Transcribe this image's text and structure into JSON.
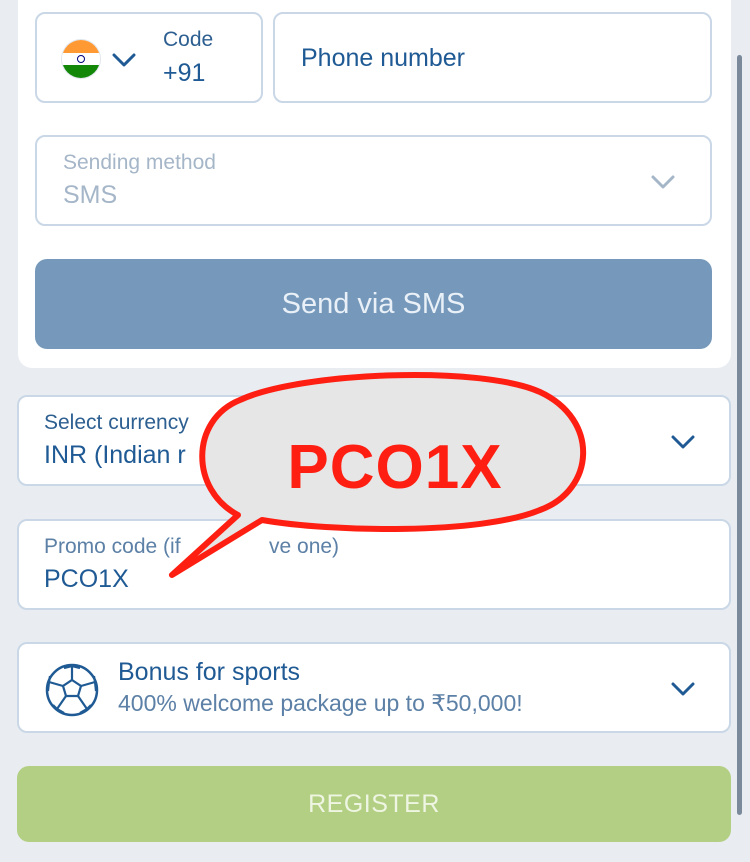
{
  "phone": {
    "country_flag": "india-flag-icon",
    "code_label": "Code",
    "code_value": "+91",
    "phone_placeholder": "Phone number"
  },
  "sending_method": {
    "label": "Sending method",
    "value": "SMS"
  },
  "send_button": "Send via SMS",
  "currency": {
    "label": "Select currency",
    "value": "INR (Indian r"
  },
  "promo": {
    "label": "Promo code (if",
    "label_tail": "ve one)",
    "value": "PCO1X"
  },
  "bonus": {
    "title": "Bonus for sports",
    "subtitle": "400% welcome package up to ₹50,000!",
    "icon": "soccer-ball-icon"
  },
  "register_button": "REGISTER",
  "callout": {
    "text": "PCO1X"
  },
  "colors": {
    "accent_blue": "#1f5a94",
    "send_button_bg": "#7699bb",
    "register_bg": "#b3cf83",
    "callout_red": "#ff1f12"
  }
}
